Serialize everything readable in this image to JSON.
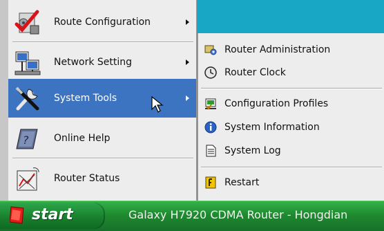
{
  "main_menu": {
    "items": [
      {
        "label": "Route Configuration",
        "icon": "route-config-icon",
        "has_submenu": true
      },
      {
        "label": "Network Setting",
        "icon": "network-icon",
        "has_submenu": true
      },
      {
        "label": "System Tools",
        "icon": "tools-icon",
        "has_submenu": true,
        "active": true
      },
      {
        "label": "Online Help",
        "icon": "help-book-icon",
        "has_submenu": false
      },
      {
        "label": "Router Status",
        "icon": "router-status-icon",
        "has_submenu": false
      }
    ]
  },
  "sub_menu": {
    "items": [
      {
        "label": "Router Administration",
        "icon": "admin-icon"
      },
      {
        "label": "Router Clock",
        "icon": "clock-icon"
      },
      {
        "label": "Configuration Profiles",
        "icon": "profiles-icon"
      },
      {
        "label": "System Information",
        "icon": "info-icon"
      },
      {
        "label": "System Log",
        "icon": "log-icon"
      },
      {
        "label": "Restart",
        "icon": "restart-icon"
      }
    ]
  },
  "taskbar": {
    "start_label": "start",
    "title": "Galaxy H7920 CDMA Router - Hongdian"
  },
  "colors": {
    "highlight": "#3d74c2",
    "menu_bg": "#ededed",
    "desktop": "#19a9c6",
    "taskbar": "#1f8a2f"
  }
}
